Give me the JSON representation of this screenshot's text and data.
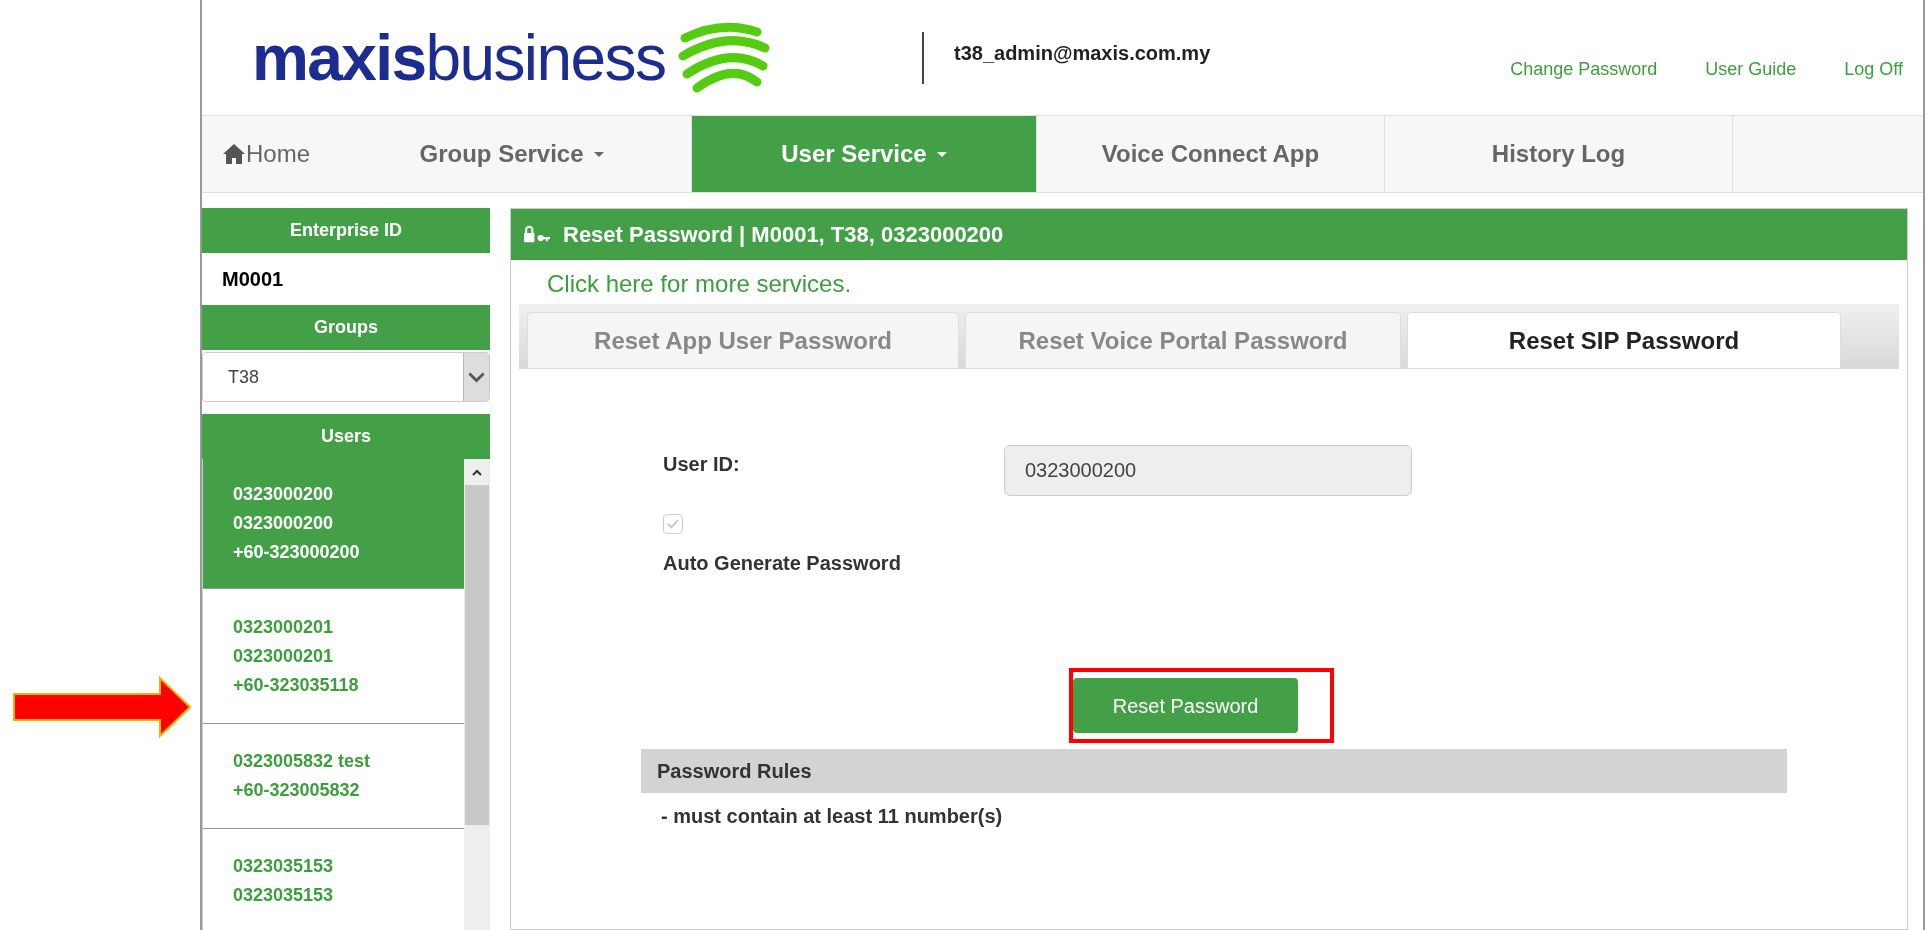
{
  "header": {
    "logo_text_bold": "maxis",
    "logo_text": "business",
    "account": "t38_admin@maxis.com.my",
    "links": [
      "Change Password",
      "User Guide",
      "Log Off"
    ]
  },
  "nav": [
    {
      "label": "Home",
      "kind": "home",
      "selected": false
    },
    {
      "label": "Group Service",
      "kind": "dropdown",
      "selected": false
    },
    {
      "label": "User Service",
      "kind": "dropdown",
      "selected": true
    },
    {
      "label": "Voice Connect App",
      "kind": "plain",
      "selected": false
    },
    {
      "label": "History Log",
      "kind": "plain",
      "selected": false
    }
  ],
  "sidebar": {
    "enterprise_heading": "Enterprise ID",
    "enterprise_id": "M0001",
    "groups_heading": "Groups",
    "group_value": "T38",
    "users_heading": "Users",
    "users": [
      {
        "lines": [
          "0323000200",
          "0323000200",
          "+60-323000200"
        ],
        "selected": true
      },
      {
        "lines": [
          "0323000201",
          "0323000201",
          "+60-323035118"
        ],
        "selected": false
      },
      {
        "lines": [
          "0323005832 test",
          "+60-323005832"
        ],
        "selected": false
      },
      {
        "lines": [
          "0323035153",
          "0323035153"
        ],
        "selected": false
      }
    ]
  },
  "panel": {
    "title": "Reset Password | M0001, T38, 0323000200",
    "more_link": "Click here for more services.",
    "tabs": [
      {
        "label": "Reset App User Password",
        "selected": false
      },
      {
        "label": "Reset Voice Portal Password",
        "selected": false
      },
      {
        "label": "Reset SIP Password",
        "selected": true
      }
    ],
    "user_id_label": "User ID:",
    "user_id_value": "0323000200",
    "auto_generate": {
      "label": "Auto Generate Password",
      "checked": true,
      "disabled": true
    },
    "button": "Reset Password",
    "button_highlighted": true,
    "rules_heading": "Password Rules",
    "rules": [
      "- must contain at least 11 number(s)"
    ]
  },
  "annotation_arrow": true
}
